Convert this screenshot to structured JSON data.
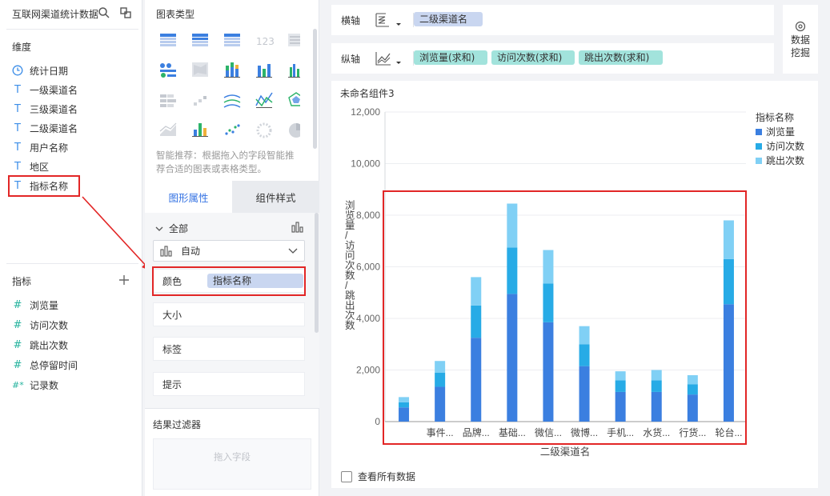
{
  "left": {
    "title": "互联网渠道统计数据",
    "dimension_label": "维度",
    "dimensions": [
      {
        "label": "统计日期",
        "icon": "clock-icon"
      },
      {
        "label": "一级渠道名",
        "icon": "text-type-icon"
      },
      {
        "label": "三级渠道名",
        "icon": "text-type-icon"
      },
      {
        "label": "二级渠道名",
        "icon": "text-type-icon"
      },
      {
        "label": "用户名称",
        "icon": "text-type-icon"
      },
      {
        "label": "地区",
        "icon": "text-type-icon"
      },
      {
        "label": "指标名称",
        "icon": "text-type-icon"
      }
    ],
    "metric_label": "指标",
    "metrics": [
      {
        "label": "浏览量",
        "icon": "#"
      },
      {
        "label": "访问次数",
        "icon": "#"
      },
      {
        "label": "跳出次数",
        "icon": "#"
      },
      {
        "label": "总停留时间",
        "icon": "#"
      },
      {
        "label": "记录数",
        "icon": "#*"
      }
    ]
  },
  "middle": {
    "chart_type_title": "图表类型",
    "smart_recommend": "智能推荐：根据拖入的字段智能推荐合适的图表或表格类型。",
    "tab_graph": "图形属性",
    "tab_style": "组件样式",
    "all_label": "全部",
    "auto_label": "自动",
    "color_label": "颜色",
    "color_chip": "指标名称",
    "size_label": "大小",
    "tag_label": "标签",
    "tooltip_label": "提示",
    "filter_title": "结果过滤器",
    "filter_placeholder": "拖入字段"
  },
  "axes": {
    "x_label": "横轴",
    "x_field": "二级渠道名",
    "y_label": "纵轴",
    "y_fields": [
      "浏览量(求和)",
      "访问次数(求和)",
      "跳出次数(求和)"
    ],
    "mining_label_1": "数据",
    "mining_label_2": "挖掘"
  },
  "widget": {
    "name": "未命名组件3",
    "view_all": "查看所有数据",
    "colors": {
      "浏览量": "#3b7fe0",
      "访问次数": "#27abe6",
      "跳出次数": "#80d0f5"
    }
  },
  "chart_data": {
    "type": "bar",
    "stacked": true,
    "xlabel": "二级渠道名",
    "ylabel": "浏览量/访问次数/跳出次数",
    "ylim": [
      0,
      12000
    ],
    "yticks": [
      "0",
      "2,000",
      "4,000",
      "6,000",
      "8,000",
      "10,000",
      "12,000"
    ],
    "ytick_values": [
      0,
      2000,
      4000,
      6000,
      8000,
      10000,
      12000
    ],
    "categories": [
      "",
      "事件...",
      "品牌...",
      "基础...",
      "微信...",
      "微博...",
      "手机...",
      "水货...",
      "行货...",
      "轮台..."
    ],
    "legend_title": "指标名称",
    "legend_position": "right",
    "series": [
      {
        "name": "浏览量",
        "values": [
          550,
          1350,
          3250,
          4950,
          3850,
          2150,
          1150,
          1150,
          1050,
          4550
        ]
      },
      {
        "name": "访问次数",
        "values": [
          200,
          550,
          1250,
          1800,
          1500,
          850,
          450,
          450,
          400,
          1750
        ]
      },
      {
        "name": "跳出次数",
        "values": [
          200,
          450,
          1100,
          1700,
          1300,
          700,
          350,
          400,
          350,
          1500
        ]
      }
    ]
  }
}
